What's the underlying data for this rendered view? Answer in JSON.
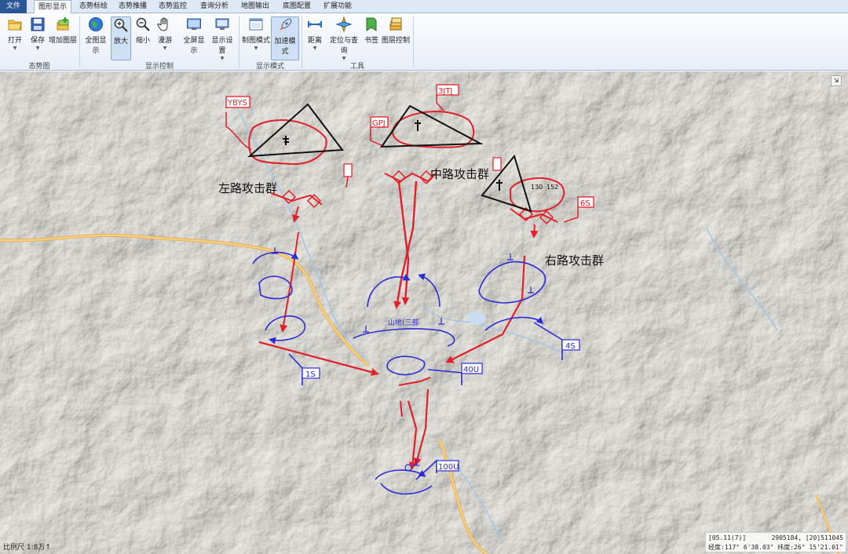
{
  "tabs": [
    "文件",
    "图形显示",
    "态势标绘",
    "态势推播",
    "态势监控",
    "查询分析",
    "地图输出",
    "底图配置",
    "扩展功能"
  ],
  "ribbon": {
    "groups": {
      "situation": "态势图",
      "display_control": "显示控制",
      "display_mode": "显示模式",
      "tools": "工具"
    },
    "buttons": {
      "open": "打开",
      "save": "保存",
      "add_layer": "增加图层",
      "full_view": "全图显示",
      "zoom_in": "放大",
      "zoom_out": "缩小",
      "pan": "漫游",
      "fullscreen": "全屏显示",
      "display_settings": "显示设置",
      "draw_mode": "制图模式",
      "accel_mode": "加速模式",
      "distance": "距离",
      "locate_query": "定位与查询",
      "bookmark": "书签",
      "layer_control": "图层控制"
    }
  },
  "map": {
    "labels": {
      "left_group": "左路攻击群",
      "center_group": "中路攻击群",
      "right_group": "右路攻击群",
      "center_enemy": "山地(三部"
    },
    "flags": {
      "ybys": "YBYS",
      "gpj": "GPJ",
      "jtj": "3JTJ",
      "s6": "6S",
      "s1": "1S",
      "s4": "4S",
      "u40": "40U",
      "u100": "100U"
    },
    "numbers": {
      "n130": "130",
      "n152": "152"
    },
    "colors": {
      "friendly": "#e0212b",
      "enemy": "#2b2bd6",
      "road": "#f1c36d",
      "water": "#9dc7e8"
    }
  },
  "status": {
    "scale": "比例尺 1:8万↑",
    "line1_left": "[05.11(7)]",
    "line1_right": "2905184, [20]511045",
    "line2": "经度:117° 6'38.03\"  纬度:26° 15'21.01\""
  }
}
